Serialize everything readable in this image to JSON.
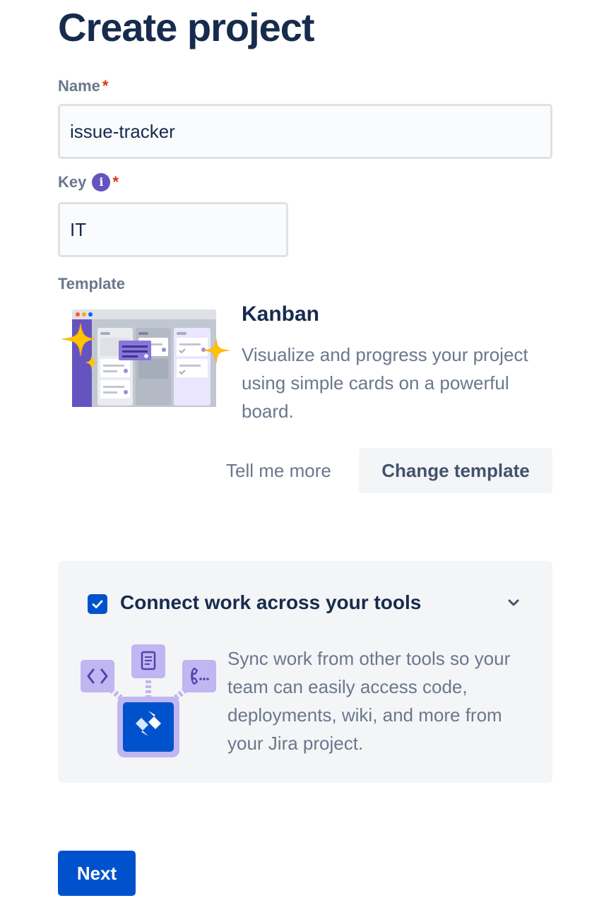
{
  "page": {
    "title": "Create project"
  },
  "form": {
    "name": {
      "label": "Name",
      "required_mark": "*",
      "value": "issue-tracker"
    },
    "key": {
      "label": "Key",
      "info_glyph": "i",
      "required_mark": "*",
      "value": "IT"
    },
    "template": {
      "label": "Template",
      "name": "Kanban",
      "description": "Visualize and progress your project using simple cards on a powerful board.",
      "tell_me_more_label": "Tell me more",
      "change_template_label": "Change template"
    }
  },
  "connect_panel": {
    "checked": true,
    "title": "Connect work across your tools",
    "description": "Sync work from other tools so your team can easily access code, deployments, wiki, and more from your Jira project."
  },
  "actions": {
    "next_label": "Next"
  },
  "colors": {
    "primary": "#0052cc",
    "heading": "#172b4d",
    "subtle_text": "#6b778c",
    "required": "#de350b",
    "info": "#6554c0",
    "panel_bg": "#f4f5f7"
  }
}
